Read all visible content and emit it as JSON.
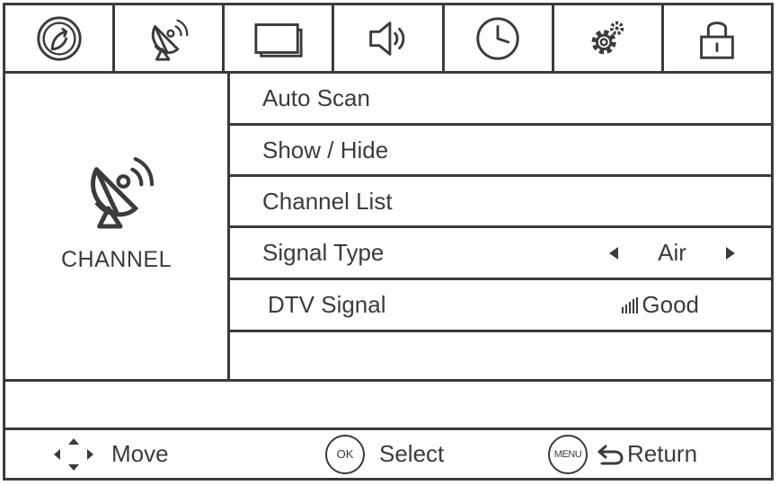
{
  "tabs": [
    {
      "icon": "picture-swirl-icon"
    },
    {
      "icon": "satellite-dish-icon"
    },
    {
      "icon": "screen-icon"
    },
    {
      "icon": "speaker-icon"
    },
    {
      "icon": "clock-icon"
    },
    {
      "icon": "gears-icon"
    },
    {
      "icon": "lock-icon"
    }
  ],
  "category": {
    "label": "CHANNEL",
    "icon": "satellite-dish-icon"
  },
  "menu": {
    "auto_scan": "Auto Scan",
    "show_hide": "Show / Hide",
    "channel_list": "Channel List",
    "signal_type": {
      "label": "Signal Type",
      "value": "Air"
    },
    "dtv_signal": {
      "label": "DTV Signal",
      "value": "Good"
    }
  },
  "footer": {
    "move_label": "Move",
    "ok_button": "OK",
    "select_label": "Select",
    "menu_button": "MENU",
    "return_label": "Return"
  },
  "colors": {
    "foreground": "#3b3b3b",
    "background": "#ffffff"
  }
}
